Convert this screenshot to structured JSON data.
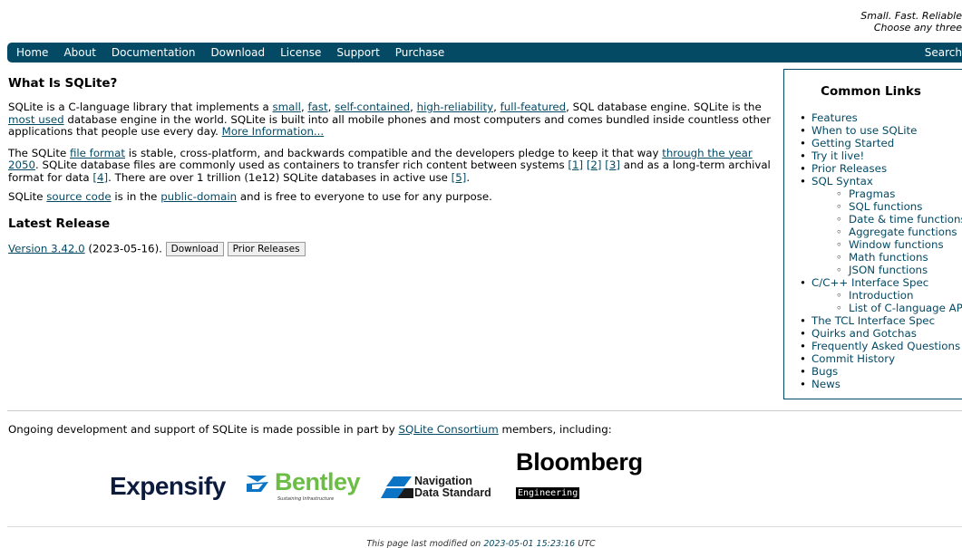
{
  "tagline": {
    "line1": "Small. Fast. Reliable",
    "line2": "Choose any three"
  },
  "menu": {
    "items": [
      "Home",
      "About",
      "Documentation",
      "Download",
      "License",
      "Support",
      "Purchase"
    ],
    "search": "Search"
  },
  "main": {
    "heading": "What Is SQLite?",
    "p1": {
      "t1": "SQLite is a C-language library that implements a ",
      "small": "small",
      "c1": ", ",
      "fast": "fast",
      "c2": ", ",
      "self_contained": "self-contained",
      "c3": ", ",
      "high_reliability": "high-reliability",
      "c4": ", ",
      "full_featured": "full-featured",
      "t2": ", SQL database engine. SQLite is the ",
      "most_used": "most used",
      "t3": " database engine in the world. SQLite is built into all mobile phones and most computers and comes bundled inside countless other applications that people use every day. ",
      "more_info": "More Information..."
    },
    "p2": {
      "t1": "The SQLite ",
      "file_format": "file format",
      "t2": " is stable, cross-platform, and backwards compatible and the developers pledge to keep it that way ",
      "through": "through the year 2050",
      "t3": ". SQLite database files are commonly used as containers to transfer rich content between systems ",
      "ref1": "[1]",
      "ref2": "[2]",
      "ref3": "[3]",
      "t4": " and as a long-term archival format for data ",
      "ref4": "[4]",
      "t5": ". There are over 1 trillion (1e12) SQLite databases in active use ",
      "ref5": "[5]",
      "t6": "."
    },
    "p3": {
      "t1": "SQLite ",
      "source_code": "source code",
      "t2": " is in the ",
      "public_domain": "public-domain",
      "t3": " and is free to everyone to use for any purpose."
    },
    "latest_heading": "Latest Release",
    "release": {
      "version": "Version 3.42.0",
      "date": " (2023-05-16). ",
      "download_btn": "Download",
      "prior_btn": "Prior Releases"
    }
  },
  "sidebar": {
    "title": "Common Links",
    "items": [
      {
        "label": "Features",
        "level": 1
      },
      {
        "label": "When to use SQLite",
        "level": 1
      },
      {
        "label": "Getting Started",
        "level": 1
      },
      {
        "label": "Try it live!",
        "level": 1
      },
      {
        "label": "Prior Releases",
        "level": 1
      },
      {
        "label": "SQL Syntax",
        "level": 1
      },
      {
        "label": "Pragmas",
        "level": 2
      },
      {
        "label": "SQL functions",
        "level": 2
      },
      {
        "label": "Date & time functions",
        "level": 2
      },
      {
        "label": "Aggregate functions",
        "level": 2
      },
      {
        "label": "Window functions",
        "level": 2
      },
      {
        "label": "Math functions",
        "level": 2
      },
      {
        "label": "JSON functions",
        "level": 2
      },
      {
        "label": "C/C++ Interface Spec",
        "level": 1
      },
      {
        "label": "Introduction",
        "level": 2
      },
      {
        "label": "List of C-language APIs",
        "level": 2
      },
      {
        "label": "The TCL Interface Spec",
        "level": 1
      },
      {
        "label": "Quirks and Gotchas",
        "level": 1
      },
      {
        "label": "Frequently Asked Questions",
        "level": 1
      },
      {
        "label": "Commit History",
        "level": 1
      },
      {
        "label": "Bugs",
        "level": 1
      },
      {
        "label": "News",
        "level": 1
      }
    ]
  },
  "consortium": {
    "t1": "Ongoing development and support of SQLite is made possible in part by ",
    "link": "SQLite Consortium",
    "t2": " members, including:"
  },
  "sponsors": {
    "expensify": "Expensify",
    "bentley": "Bentley",
    "bentley_sub": "Sustaining Infrastructure",
    "nds_line1": "Navigation",
    "nds_line2": "Data Standard",
    "bloomberg": "Bloomberg",
    "bloomberg_sub": "Engineering"
  },
  "footer": {
    "t1": "This page last modified on ",
    "date": "2023-05-01 15:23:16",
    "t2": " UTC"
  },
  "colors": {
    "brand": "#044a64",
    "bentley_green": "#6cbd45",
    "nds_blue": "#0b74c4"
  }
}
